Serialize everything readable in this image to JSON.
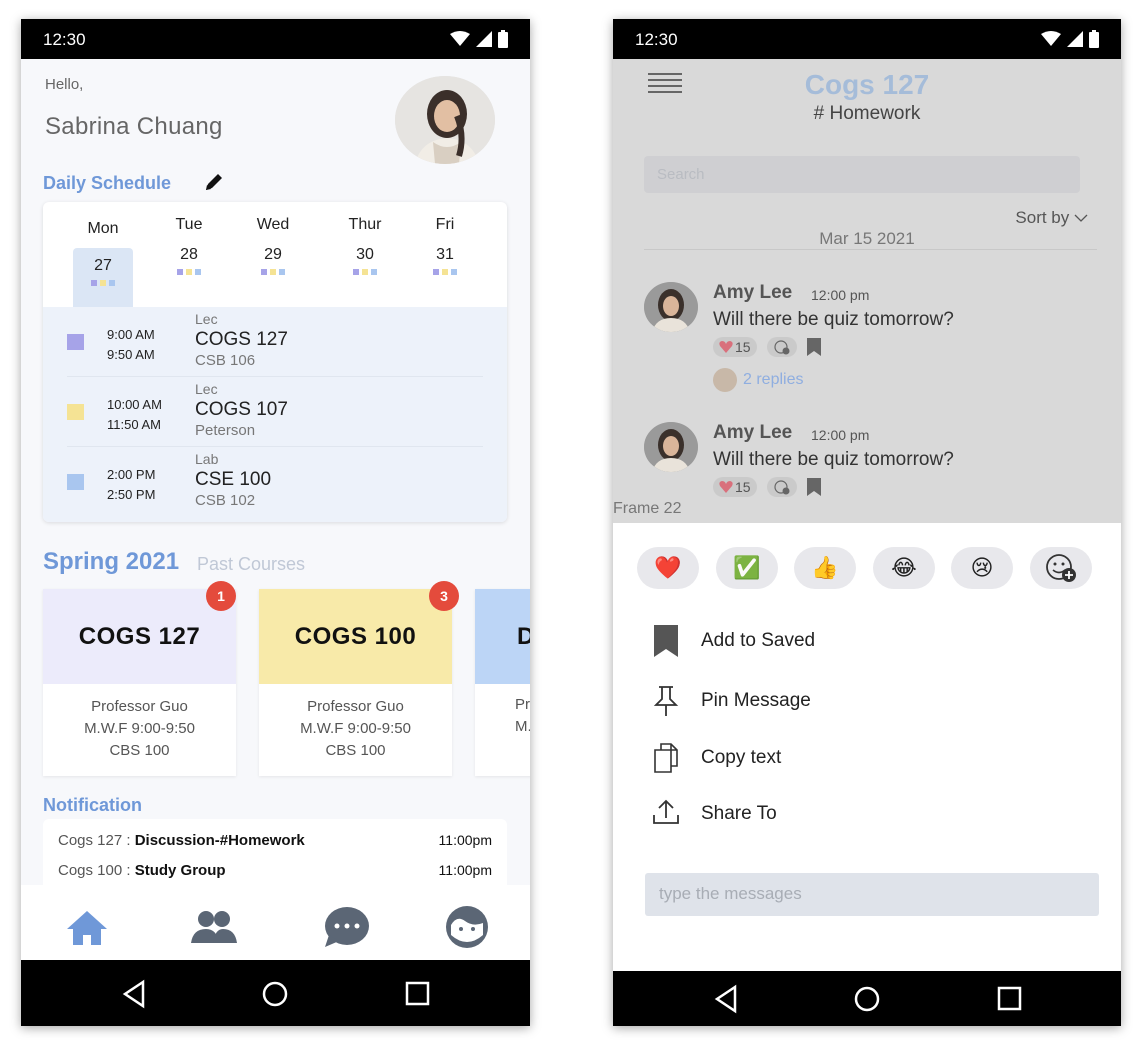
{
  "status_bar": {
    "time": "12:30"
  },
  "home": {
    "greeting": "Hello,",
    "user_name": "Sabrina Chuang",
    "daily_schedule_title": "Daily Schedule",
    "days": [
      {
        "name": "Mon",
        "date": "27",
        "selected": true
      },
      {
        "name": "Tue",
        "date": "28"
      },
      {
        "name": "Wed",
        "date": "29"
      },
      {
        "name": "Thur",
        "date": "30"
      },
      {
        "name": "Fri",
        "date": "31"
      }
    ],
    "classes": [
      {
        "start": "9:00 AM",
        "end": "9:50 AM",
        "type": "Lec",
        "course": "COGS 127",
        "location": "CSB 106",
        "color": "#a6a3e8"
      },
      {
        "start": "10:00 AM",
        "end": "11:50  AM",
        "type": "Lec",
        "course": "COGS 107",
        "location": "Peterson",
        "color": "#f5e394"
      },
      {
        "start": "2:00 PM",
        "end": "2:50 PM",
        "type": "Lab",
        "course": "CSE 100",
        "location": "CSB 102",
        "color": "#a9c6ef"
      }
    ],
    "semester_title": "Spring 2021",
    "past_courses_label": "Past Courses",
    "courses": [
      {
        "code": "COGS 127",
        "professor": "Professor Guo",
        "schedule": "M.W.F  9:00-9:50",
        "room": "CBS 100",
        "badge": "1",
        "color": "#ecebfb"
      },
      {
        "code": "COGS 100",
        "professor": "Professor Guo",
        "schedule": "M.W.F  9:00-9:50",
        "room": "CBS 100",
        "badge": "3",
        "color": "#f8eaa9"
      },
      {
        "code": "D",
        "professor": "Pr",
        "schedule": "M.W",
        "room": "",
        "color": "#bcd5f6"
      }
    ],
    "notification_title": "Notification",
    "notifications": [
      {
        "course": "Cogs 127 : ",
        "topic": "Discussion-#Homework",
        "time": "11:00pm"
      },
      {
        "course": "Cogs 100 : ",
        "topic": "Study Group",
        "time": "11:00pm"
      }
    ]
  },
  "chat": {
    "channel": "Cogs 127",
    "subchannel": "# Homework",
    "search_placeholder": "Search",
    "sort_label": "Sort by",
    "date": "Mar 15 2021",
    "messages": [
      {
        "author": "Amy Lee",
        "time": "12:00 pm",
        "text": "Will there be quiz tomorrow?",
        "likes": "15",
        "replies": "2 replies"
      },
      {
        "author": "Amy Lee",
        "time": "12:00 pm",
        "text": "Will there be quiz tomorrow?",
        "likes": "15"
      }
    ],
    "frame_label": "Frame 22",
    "emoji_reactions": [
      "❤️",
      "✅",
      "👍",
      "😂",
      "😢"
    ],
    "actions": [
      {
        "label": "Add to Saved",
        "icon": "bookmark-icon"
      },
      {
        "label": "Pin Message",
        "icon": "pin-icon"
      },
      {
        "label": "Copy text",
        "icon": "copy-icon"
      },
      {
        "label": "Share To",
        "icon": "share-icon"
      }
    ],
    "input_placeholder": "type the messages"
  },
  "colors": {
    "accent": "#6f98d8",
    "badge": "#e44b3c",
    "channel_title": "#a5bcd9"
  }
}
